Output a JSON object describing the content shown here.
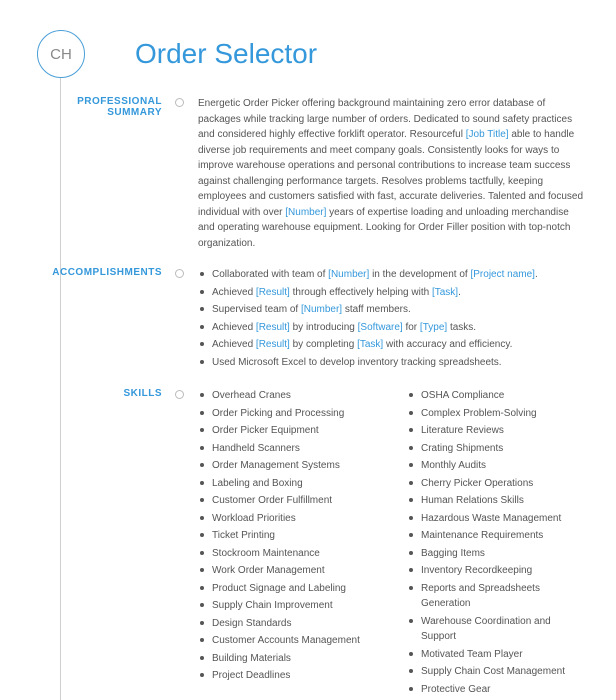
{
  "avatar_initials": "CH",
  "title": "Order Selector",
  "sections": {
    "summary": {
      "label": "PROFESSIONAL SUMMARY",
      "parts": [
        {
          "t": "Energetic Order Picker offering background maintaining zero error database of packages while tracking large number of orders. Dedicated to sound safety practices and considered highly effective forklift operator. Resourceful "
        },
        {
          "t": "[Job Title]",
          "p": true
        },
        {
          "t": " able to handle diverse job requirements and meet company goals. Consistently looks for ways to improve warehouse operations and personal contributions to increase team success against challenging performance targets. Resolves problems tactfully, keeping employees and customers satisfied with fast, accurate deliveries. Talented and focused individual with over "
        },
        {
          "t": "[Number]",
          "p": true
        },
        {
          "t": " years of expertise loading and unloading merchandise and operating warehouse equipment. Looking for Order Filler position with top-notch organization."
        }
      ]
    },
    "accomplishments": {
      "label": "ACCOMPLISHMENTS",
      "items": [
        [
          {
            "t": "Collaborated with team of "
          },
          {
            "t": "[Number]",
            "p": true
          },
          {
            "t": " in the development of "
          },
          {
            "t": "[Project name]",
            "p": true
          },
          {
            "t": "."
          }
        ],
        [
          {
            "t": "Achieved "
          },
          {
            "t": "[Result]",
            "p": true
          },
          {
            "t": " through effectively helping with "
          },
          {
            "t": "[Task]",
            "p": true
          },
          {
            "t": "."
          }
        ],
        [
          {
            "t": "Supervised team of "
          },
          {
            "t": "[Number]",
            "p": true
          },
          {
            "t": " staff members."
          }
        ],
        [
          {
            "t": "Achieved "
          },
          {
            "t": "[Result]",
            "p": true
          },
          {
            "t": " by introducing "
          },
          {
            "t": "[Software]",
            "p": true
          },
          {
            "t": " for "
          },
          {
            "t": "[Type]",
            "p": true
          },
          {
            "t": " tasks."
          }
        ],
        [
          {
            "t": "Achieved "
          },
          {
            "t": "[Result]",
            "p": true
          },
          {
            "t": " by completing "
          },
          {
            "t": "[Task]",
            "p": true
          },
          {
            "t": " with accuracy and efficiency."
          }
        ],
        [
          {
            "t": "Used Microsoft Excel to develop inventory tracking spreadsheets."
          }
        ]
      ]
    },
    "skills": {
      "label": "SKILLS",
      "col1": [
        "Overhead Cranes",
        "Order Picking and Processing",
        "Order Picker Equipment",
        "Handheld Scanners",
        "Order Management Systems",
        "Labeling and Boxing",
        "Customer Order Fulfillment",
        "Workload Priorities",
        "Ticket Printing",
        "Stockroom Maintenance",
        "Work Order Management",
        "Product Signage and Labeling",
        "Supply Chain Improvement",
        "Design Standards",
        "Customer Accounts Management",
        "Building Materials",
        "Project Deadlines"
      ],
      "col2": [
        "OSHA Compliance",
        "Complex Problem-Solving",
        "Literature Reviews",
        "Crating Shipments",
        "Monthly Audits",
        "Cherry Picker Operations",
        "Human Relations Skills",
        "Hazardous Waste Management",
        "Maintenance Requirements",
        "Bagging Items",
        "Inventory Recordkeeping",
        "Reports and Spreadsheets Generation",
        "Warehouse Coordination and Support",
        "Motivated Team Player",
        "Supply Chain Cost Management",
        "Protective Gear"
      ]
    }
  }
}
